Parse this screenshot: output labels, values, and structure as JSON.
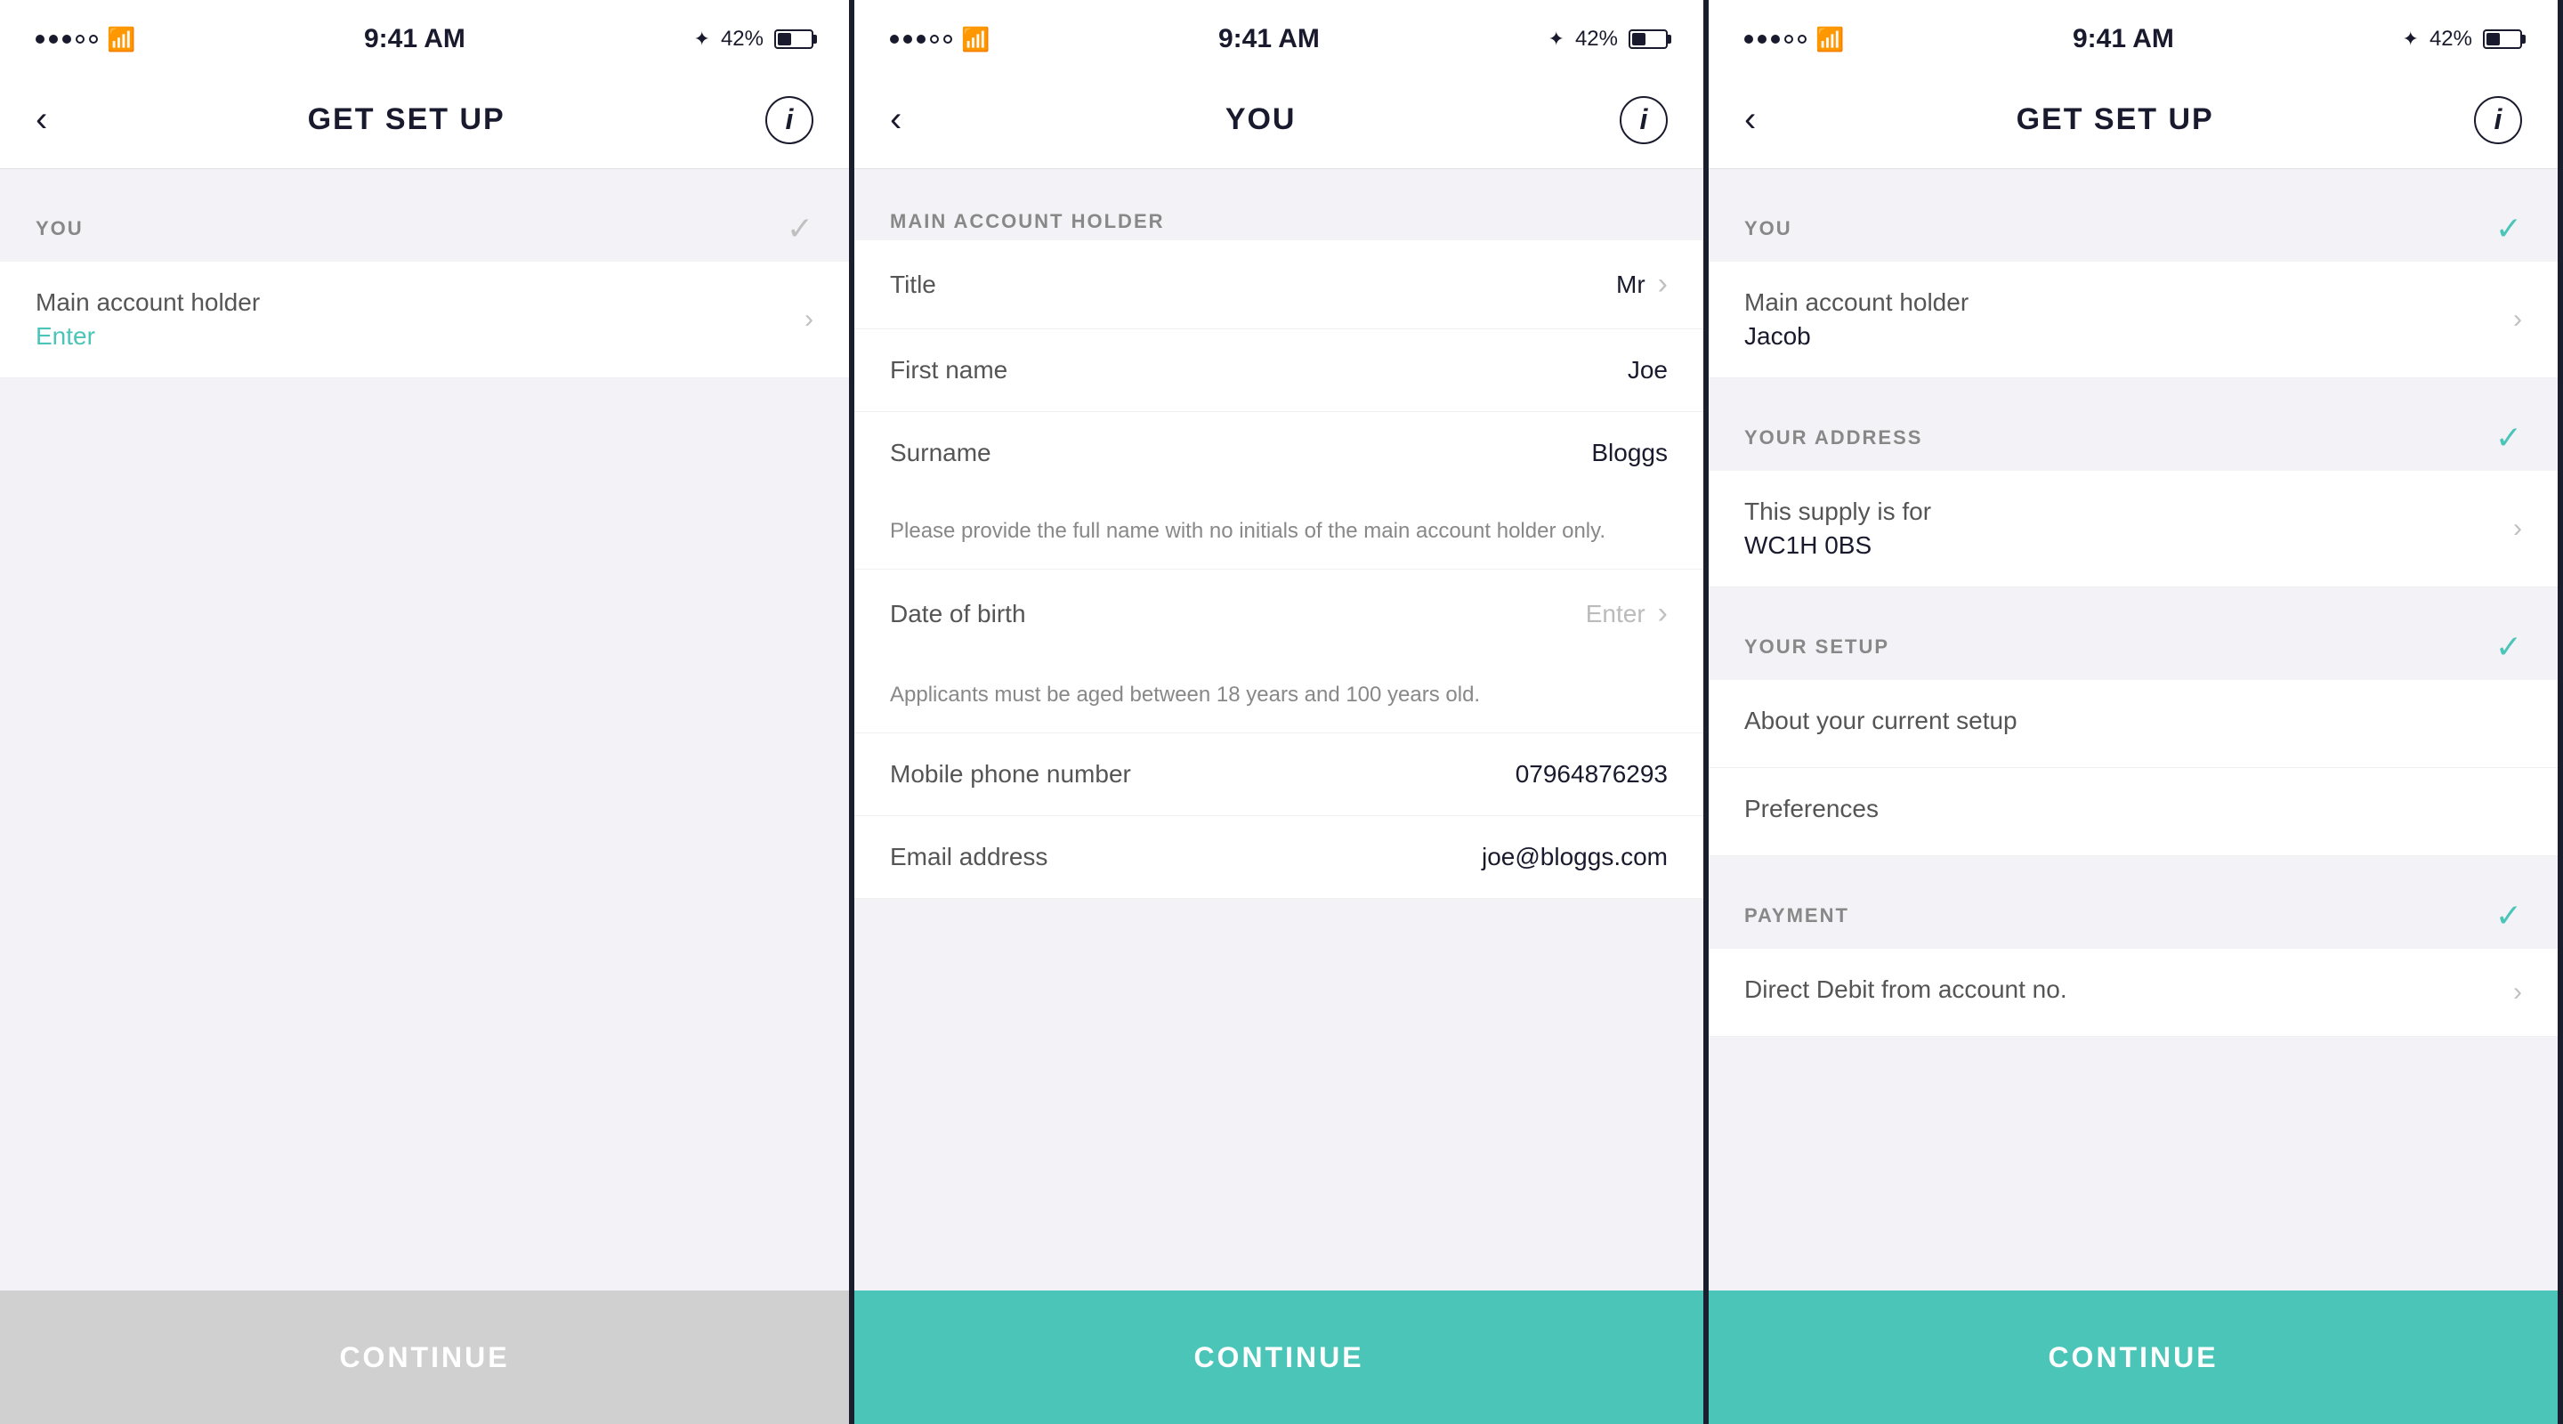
{
  "screens": [
    {
      "id": "screen1",
      "status": {
        "time": "9:41 AM",
        "battery": "42%",
        "dots": [
          true,
          true,
          true,
          false,
          false
        ]
      },
      "nav": {
        "title": "GET SET UP",
        "back_label": "‹",
        "info_label": "i"
      },
      "sections": [
        {
          "id": "you",
          "title": "YOU",
          "has_check": false,
          "items": [
            {
              "label": "Main account holder",
              "value": "",
              "placeholder": "Enter",
              "has_chevron": true
            }
          ]
        }
      ],
      "continue": {
        "label": "CONTINUE",
        "active": false
      }
    },
    {
      "id": "screen2",
      "status": {
        "time": "9:41 AM",
        "battery": "42%",
        "dots": [
          true,
          true,
          true,
          false,
          false
        ]
      },
      "nav": {
        "title": "YOU",
        "back_label": "‹",
        "info_label": "i"
      },
      "section_title": "MAIN ACCOUNT HOLDER",
      "fields": [
        {
          "label": "Title",
          "value": "Mr",
          "placeholder": "",
          "has_chevron": true,
          "note": ""
        },
        {
          "label": "First name",
          "value": "Joe",
          "placeholder": "",
          "has_chevron": false,
          "note": ""
        },
        {
          "label": "Surname",
          "value": "Bloggs",
          "placeholder": "",
          "has_chevron": false,
          "note": "Please provide the full name with no initials of the main account holder only."
        },
        {
          "label": "Date of birth",
          "value": "",
          "placeholder": "Enter",
          "has_chevron": true,
          "note": "Applicants must be aged between 18 years and 100 years old."
        },
        {
          "label": "Mobile phone number",
          "value": "07964876293",
          "placeholder": "",
          "has_chevron": false,
          "note": ""
        },
        {
          "label": "Email address",
          "value": "joe@bloggs.com",
          "placeholder": "",
          "has_chevron": false,
          "note": ""
        }
      ],
      "continue": {
        "label": "CONTINUE",
        "active": true
      }
    },
    {
      "id": "screen3",
      "status": {
        "time": "9:41 AM",
        "battery": "42%",
        "dots": [
          true,
          true,
          true,
          false,
          false
        ]
      },
      "nav": {
        "title": "GET SET UP",
        "back_label": "‹",
        "info_label": "i"
      },
      "sections": [
        {
          "id": "you",
          "title": "YOU",
          "has_check": true,
          "items": [
            {
              "label": "Main account holder",
              "value": "Jacob",
              "placeholder": "",
              "has_chevron": true
            }
          ]
        },
        {
          "id": "your-address",
          "title": "YOUR ADDRESS",
          "has_check": true,
          "items": [
            {
              "label": "This supply is for",
              "value": "WC1H 0BS",
              "placeholder": "",
              "has_chevron": true
            }
          ]
        },
        {
          "id": "your-setup",
          "title": "YOUR SETUP",
          "has_check": true,
          "items": [
            {
              "label": "About your current setup",
              "value": "",
              "placeholder": "",
              "has_chevron": false
            },
            {
              "label": "Preferences",
              "value": "",
              "placeholder": "",
              "has_chevron": false
            }
          ]
        },
        {
          "id": "payment",
          "title": "PAYMENT",
          "has_check": true,
          "items": [
            {
              "label": "Direct Debit from account no.",
              "value": "",
              "placeholder": "",
              "has_chevron": true
            }
          ]
        }
      ],
      "continue": {
        "label": "CONTINUE",
        "active": true
      }
    }
  ]
}
